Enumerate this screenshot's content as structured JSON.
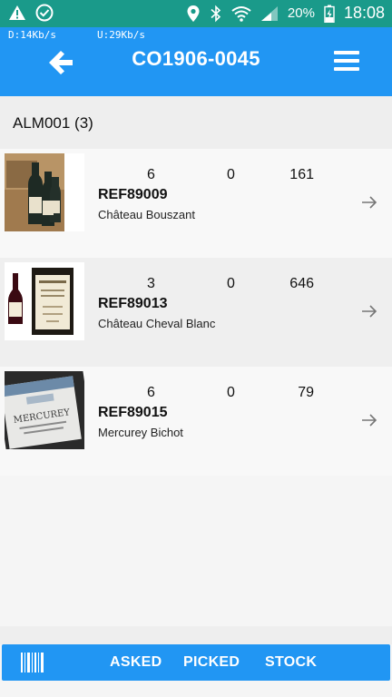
{
  "status_bar": {
    "battery_percent": "20%",
    "time": "18:08",
    "icons": [
      "warning-icon",
      "check-circle-icon",
      "location-icon",
      "bluetooth-icon",
      "wifi-icon",
      "signal-icon",
      "battery-charging-icon"
    ]
  },
  "app_bar": {
    "download_speed": "D:14Kb/s",
    "upload_speed": "U:29Kb/s",
    "title": "CO1906-0045"
  },
  "section": {
    "header": "ALM001 (3)"
  },
  "items": [
    {
      "asked": "6",
      "picked": "0",
      "stock": "161",
      "ref": "REF89009",
      "name": "Château Bouszant"
    },
    {
      "asked": "3",
      "picked": "0",
      "stock": "646",
      "ref": "REF89013",
      "name": "Château Cheval Blanc"
    },
    {
      "asked": "6",
      "picked": "0",
      "stock": "79",
      "ref": "REF89015",
      "name": "Mercurey Bichot",
      "label_text": "MERCUREY"
    }
  ],
  "bottom_bar": {
    "asked_label": "ASKED",
    "picked_label": "PICKED",
    "stock_label": "STOCK"
  },
  "colors": {
    "status_bar": "#1a9a8a",
    "primary": "#2196f3"
  }
}
